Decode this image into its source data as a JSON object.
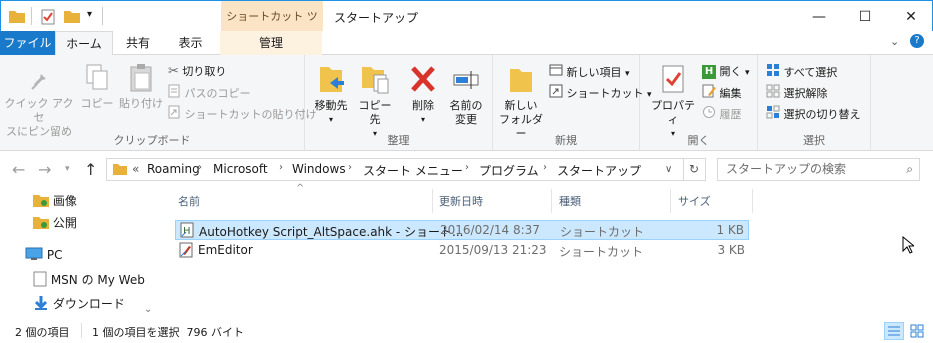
{
  "titlebar": {
    "context_tab": "ショートカット ツール",
    "title": "スタートアップ",
    "minimize": "—",
    "maximize": "☐",
    "close": "✕"
  },
  "tabs": {
    "file": "ファイル",
    "home": "ホーム",
    "share": "共有",
    "view": "表示",
    "manage": "管理"
  },
  "ribbon": {
    "clipboard": {
      "label": "クリップボード",
      "pin": "クイック アクセ\nスにピン留め",
      "copy": "コピー",
      "paste": "貼り付け",
      "cut": "切り取り",
      "copy_path": "パスのコピー",
      "paste_shortcut": "ショートカットの貼り付け"
    },
    "organize": {
      "label": "整理",
      "move_to": "移動先",
      "copy_to": "コピー先",
      "delete": "削除",
      "rename": "名前の\n変更"
    },
    "new": {
      "label": "新規",
      "new_folder": "新しい\nフォルダー",
      "new_item": "新しい項目",
      "shortcut": "ショートカット"
    },
    "open": {
      "label": "開く",
      "properties": "プロパティ",
      "open": "開く",
      "edit": "編集",
      "history": "履歴"
    },
    "select": {
      "label": "選択",
      "select_all": "すべて選択",
      "select_none": "選択解除",
      "invert": "選択の切り替え"
    }
  },
  "address": {
    "prefix": "«",
    "crumbs": [
      "Roaming",
      "Microsoft",
      "Windows",
      "スタート メニュー",
      "プログラム",
      "スタートアップ"
    ],
    "search_placeholder": "スタートアップの検索"
  },
  "nav": {
    "items": [
      "画像",
      "公開",
      "PC",
      "MSN の My Web",
      "ダウンロード"
    ]
  },
  "list": {
    "columns": [
      "名前",
      "更新日時",
      "種類",
      "サイズ"
    ],
    "rows": [
      {
        "name": "AutoHotkey Script_AltSpace.ahk - ショート...",
        "date": "2016/02/14 8:37",
        "type": "ショートカット",
        "size": "1 KB",
        "selected": true
      },
      {
        "name": "EmEditor",
        "date": "2015/09/13 21:23",
        "type": "ショートカット",
        "size": "3 KB",
        "selected": false
      }
    ]
  },
  "status": {
    "count": "2 個の項目",
    "selection": "1 個の項目を選択  796 バイト"
  },
  "colors": {
    "accent": "#1979ca",
    "selection": "#cce8ff",
    "context_tab": "#fbe4c6"
  }
}
